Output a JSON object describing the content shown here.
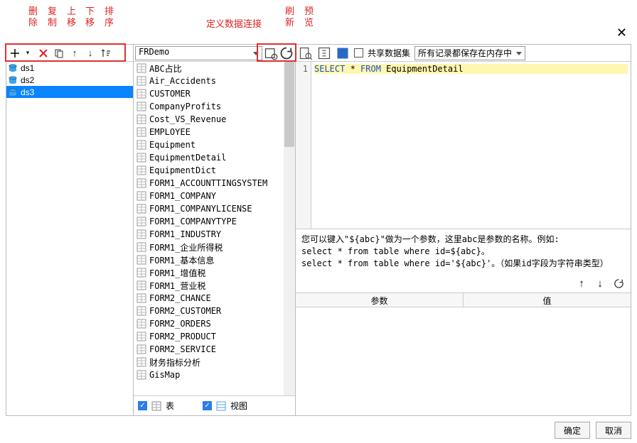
{
  "annotations": {
    "delete": "删\n除",
    "copy": "复\n制",
    "up": "上\n移",
    "down": "下\n移",
    "sort": "排\n序",
    "define_conn": "定义数据连接",
    "refresh": "刷\n新",
    "preview": "预\n览"
  },
  "close_label": "✕",
  "left": {
    "add_dropdown": "+",
    "items": [
      {
        "label": "ds1",
        "selected": false
      },
      {
        "label": "ds2",
        "selected": false
      },
      {
        "label": "ds3",
        "selected": true
      }
    ]
  },
  "mid": {
    "conn_select": "FRDemo",
    "tables": [
      "ABC占比",
      "Air_Accidents",
      "CUSTOMER",
      "CompanyProfits",
      "Cost_VS_Revenue",
      "EMPLOYEE",
      "Equipment",
      "EquipmentDetail",
      "EquipmentDict",
      "FORM1_ACCOUNTTINGSYSTEM",
      "FORM1_COMPANY",
      "FORM1_COMPANYLICENSE",
      "FORM1_COMPANYTYPE",
      "FORM1_INDUSTRY",
      "FORM1_企业所得税",
      "FORM1_基本信息",
      "FORM1_增值税",
      "FORM1_营业税",
      "FORM2_CHANCE",
      "FORM2_CUSTOMER",
      "FORM2_ORDERS",
      "FORM2_PRODUCT",
      "FORM2_SERVICE",
      "财务指标分析",
      "GisMap"
    ],
    "chk_table_label": "表",
    "chk_view_label": "视图"
  },
  "right": {
    "share_label": "共享数据集",
    "mem_select": "所有记录都保存在内存中",
    "sql_line_no": "1",
    "sql_kw1": "SELECT",
    "sql_star": " * ",
    "sql_kw2": "FROM",
    "sql_tbl": " EquipmentDetail",
    "hint_l1": "您可以键入\"${abc}\"做为一个参数，这里abc是参数的名称。例如:",
    "hint_l2": "select * from table where id=${abc}。",
    "hint_l3": "select * from table where id='${abc}'。（如果id字段为字符串类型）",
    "param_head1": "参数",
    "param_head2": "值"
  },
  "footer": {
    "ok": "确定",
    "cancel": "取消"
  }
}
